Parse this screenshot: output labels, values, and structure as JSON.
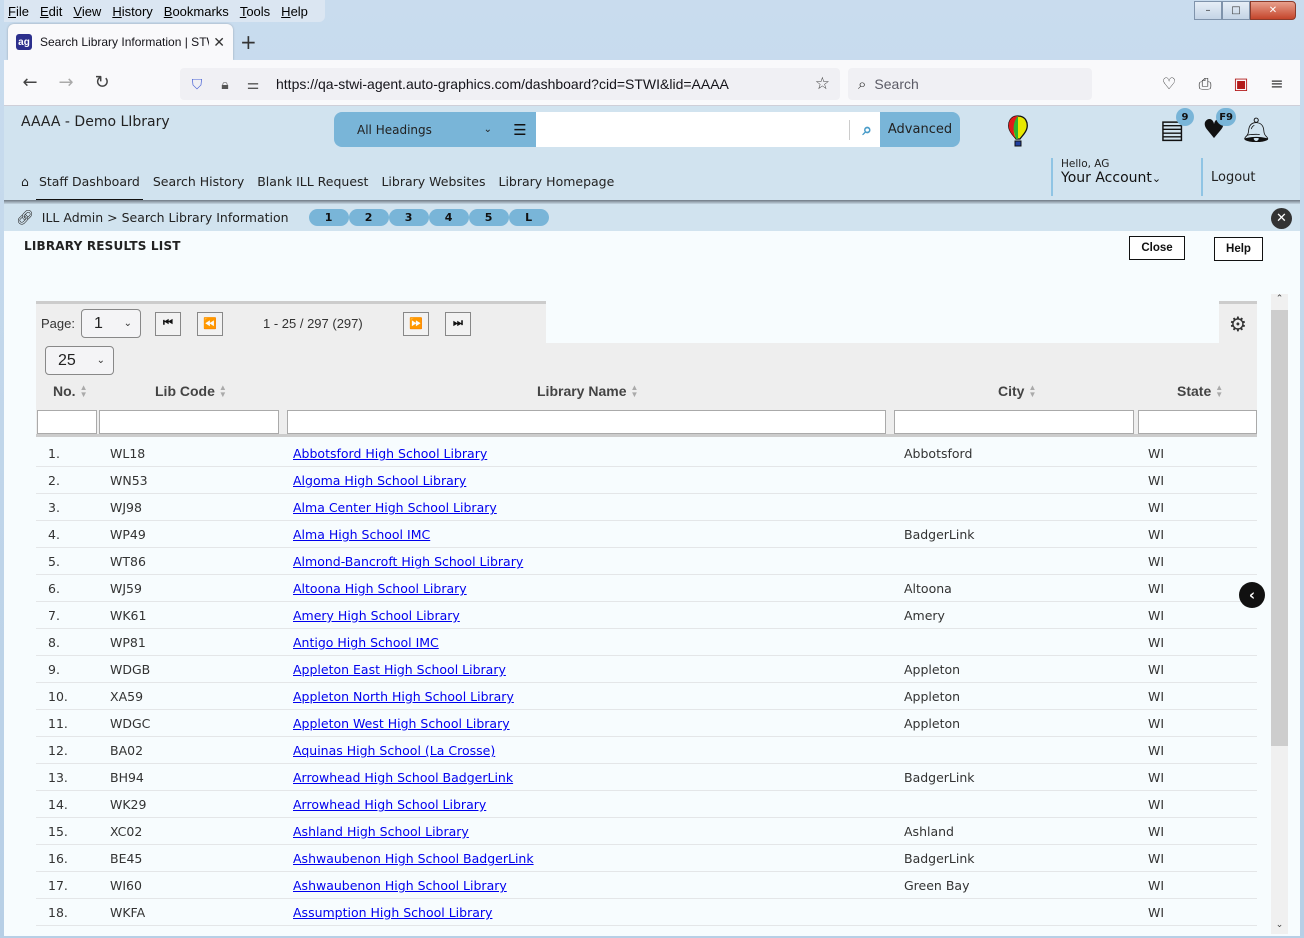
{
  "browser": {
    "menu": [
      "File",
      "Edit",
      "View",
      "History",
      "Bookmarks",
      "Tools",
      "Help"
    ],
    "tab": {
      "title": "Search Library Information | STWI",
      "favicon": "ag-logo-icon"
    },
    "url": "https://qa-stwi-agent.auto-graphics.com/dashboard?cid=STWI&lid=AAAA",
    "search_placeholder": "Search",
    "window_controls": {
      "minimize": "–",
      "maximize": "□",
      "close": "✕"
    }
  },
  "header": {
    "library_name": "AAAA - Demo LIbrary",
    "search": {
      "scope": "All Headings",
      "query": "",
      "advanced_label": "Advanced"
    },
    "badges": {
      "list": "9",
      "favorites": "F9"
    },
    "account": {
      "greeting": "Hello, AG",
      "label": "Your Account"
    },
    "logout_label": "Logout"
  },
  "nav": {
    "items": [
      "Staff Dashboard",
      "Search History",
      "Blank ILL Request",
      "Library Websites",
      "Library Homepage"
    ],
    "active": "Staff Dashboard"
  },
  "breadcrumb": {
    "text": "ILL Admin > Search Library Information",
    "steps": [
      "1",
      "2",
      "3",
      "4",
      "5",
      "L"
    ]
  },
  "results": {
    "title": "LIBRARY RESULTS LIST",
    "close_label": "Close",
    "help_label": "Help",
    "pager": {
      "label": "Page:",
      "page": "1",
      "range": "1 - 25 / 297 (297)",
      "page_size": "25"
    },
    "columns": [
      "No.",
      "Lib Code",
      "Library Name",
      "City",
      "State"
    ],
    "rows": [
      {
        "no": "1.",
        "code": "WL18",
        "name": "Abbotsford High School Library",
        "city": "Abbotsford",
        "state": "WI"
      },
      {
        "no": "2.",
        "code": "WN53",
        "name": "Algoma High School Library",
        "city": "",
        "state": "WI"
      },
      {
        "no": "3.",
        "code": "WJ98",
        "name": "Alma Center High School Library",
        "city": "",
        "state": "WI"
      },
      {
        "no": "4.",
        "code": "WP49",
        "name": "Alma High School IMC",
        "city": "BadgerLink",
        "state": "WI"
      },
      {
        "no": "5.",
        "code": "WT86",
        "name": "Almond-Bancroft High School Library",
        "city": "",
        "state": "WI"
      },
      {
        "no": "6.",
        "code": "WJ59",
        "name": "Altoona High School Library",
        "city": "Altoona",
        "state": "WI"
      },
      {
        "no": "7.",
        "code": "WK61",
        "name": "Amery High School Library",
        "city": "Amery",
        "state": "WI"
      },
      {
        "no": "8.",
        "code": "WP81",
        "name": "Antigo High School IMC",
        "city": "",
        "state": "WI"
      },
      {
        "no": "9.",
        "code": "WDGB",
        "name": "Appleton East High School Library",
        "city": "Appleton",
        "state": "WI"
      },
      {
        "no": "10.",
        "code": "XA59",
        "name": "Appleton North High School Library",
        "city": "Appleton",
        "state": "WI"
      },
      {
        "no": "11.",
        "code": "WDGC",
        "name": "Appleton West High School Library",
        "city": "Appleton",
        "state": "WI"
      },
      {
        "no": "12.",
        "code": "BA02",
        "name": "Aquinas High School (La Crosse)",
        "city": "",
        "state": "WI"
      },
      {
        "no": "13.",
        "code": "BH94",
        "name": "Arrowhead High School BadgerLink",
        "city": "BadgerLink",
        "state": "WI"
      },
      {
        "no": "14.",
        "code": "WK29",
        "name": "Arrowhead High School Library",
        "city": "",
        "state": "WI"
      },
      {
        "no": "15.",
        "code": "XC02",
        "name": "Ashland High School Library",
        "city": "Ashland",
        "state": "WI"
      },
      {
        "no": "16.",
        "code": "BE45",
        "name": "Ashwaubenon High School BadgerLink",
        "city": "BadgerLink",
        "state": "WI"
      },
      {
        "no": "17.",
        "code": "WI60",
        "name": "Ashwaubenon High School Library",
        "city": "Green Bay",
        "state": "WI"
      },
      {
        "no": "18.",
        "code": "WKFA",
        "name": "Assumption High School Library",
        "city": "",
        "state": "WI"
      }
    ]
  }
}
